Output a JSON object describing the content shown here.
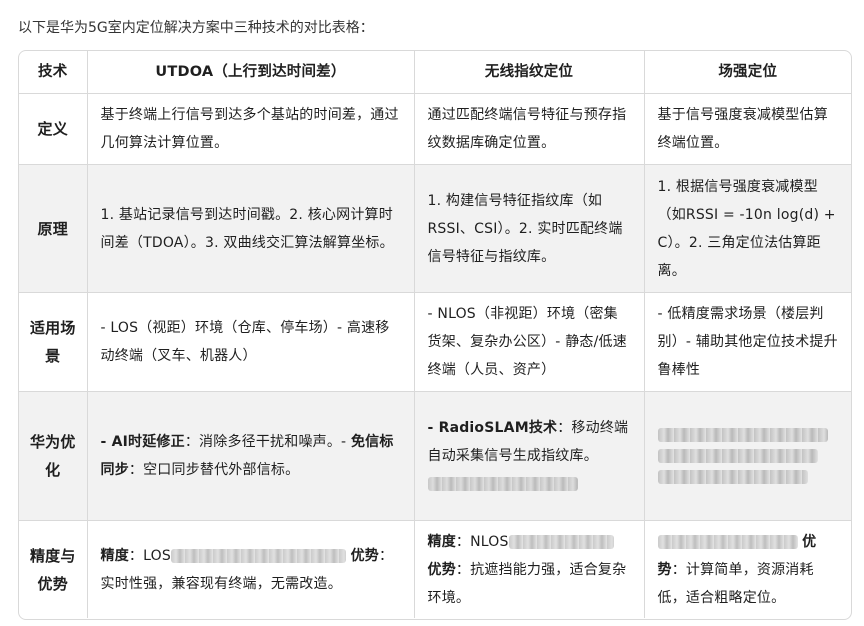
{
  "intro": "以下是华为5G室内定位解决方案中三种技术的对比表格：",
  "table": {
    "headers": [
      "技术",
      "UTDOA（上行到达时间差）",
      "无线指纹定位",
      "场强定位"
    ],
    "rows": [
      {
        "label": "定义",
        "cells": [
          {
            "text": "基于终端上行信号到达多个基站的时间差，通过几何算法计算位置。"
          },
          {
            "text": "通过匹配终端信号特征与预存指纹数据库确定位置。"
          },
          {
            "text": "基于信号强度衰减模型估算终端位置。"
          }
        ]
      },
      {
        "label": "原理",
        "cells": [
          {
            "text": "1. 基站记录信号到达时间戳。2. 核心网计算时间差（TDOA）。3. 双曲线交汇算法解算坐标。"
          },
          {
            "text": "1. 构建信号特征指纹库（如RSSI、CSI）。2. 实时匹配终端信号特征与指纹库。"
          },
          {
            "text": "1. 根据信号强度衰减模型（如RSSI = -10n log(d) + C）。2. 三角定位法估算距离。"
          }
        ]
      },
      {
        "label": "适用场景",
        "cells": [
          {
            "text": "- LOS（视距）环境（仓库、停车场）- 高速移动终端（叉车、机器人）"
          },
          {
            "text": "- NLOS（非视距）环境（密集货架、复杂办公区）- 静态/低速终端（人员、资产）"
          },
          {
            "text": "- 低精度需求场景（楼层判别）- 辅助其他定位技术提升鲁棒性"
          }
        ]
      },
      {
        "label": "华为优化",
        "cells": [
          {
            "k1": "- AI时延修正",
            "t1": "：消除多径干扰和噪声。- ",
            "k2": "免信标同步",
            "t2": "：空口同步替代外部信标。"
          },
          {
            "k1": "- RadioSLAM技术",
            "t1": "：移动终端自动采集信号生成指纹库。"
          },
          {
            "text": ""
          }
        ]
      },
      {
        "label": "精度与优势",
        "cells": [
          {
            "k1": "精度",
            "t1": "：LOS",
            "k2": "优势",
            "t2": "：实时性强，兼容现有终端，无需改造。"
          },
          {
            "k1": "精度",
            "t1": "：NLOS",
            "k2": "优势",
            "t2": "：抗遮挡能力强，适合复杂环境。"
          },
          {
            "k2": "优势",
            "t2": "：计算简单，资源消耗低，适合粗略定位。"
          }
        ]
      }
    ]
  }
}
